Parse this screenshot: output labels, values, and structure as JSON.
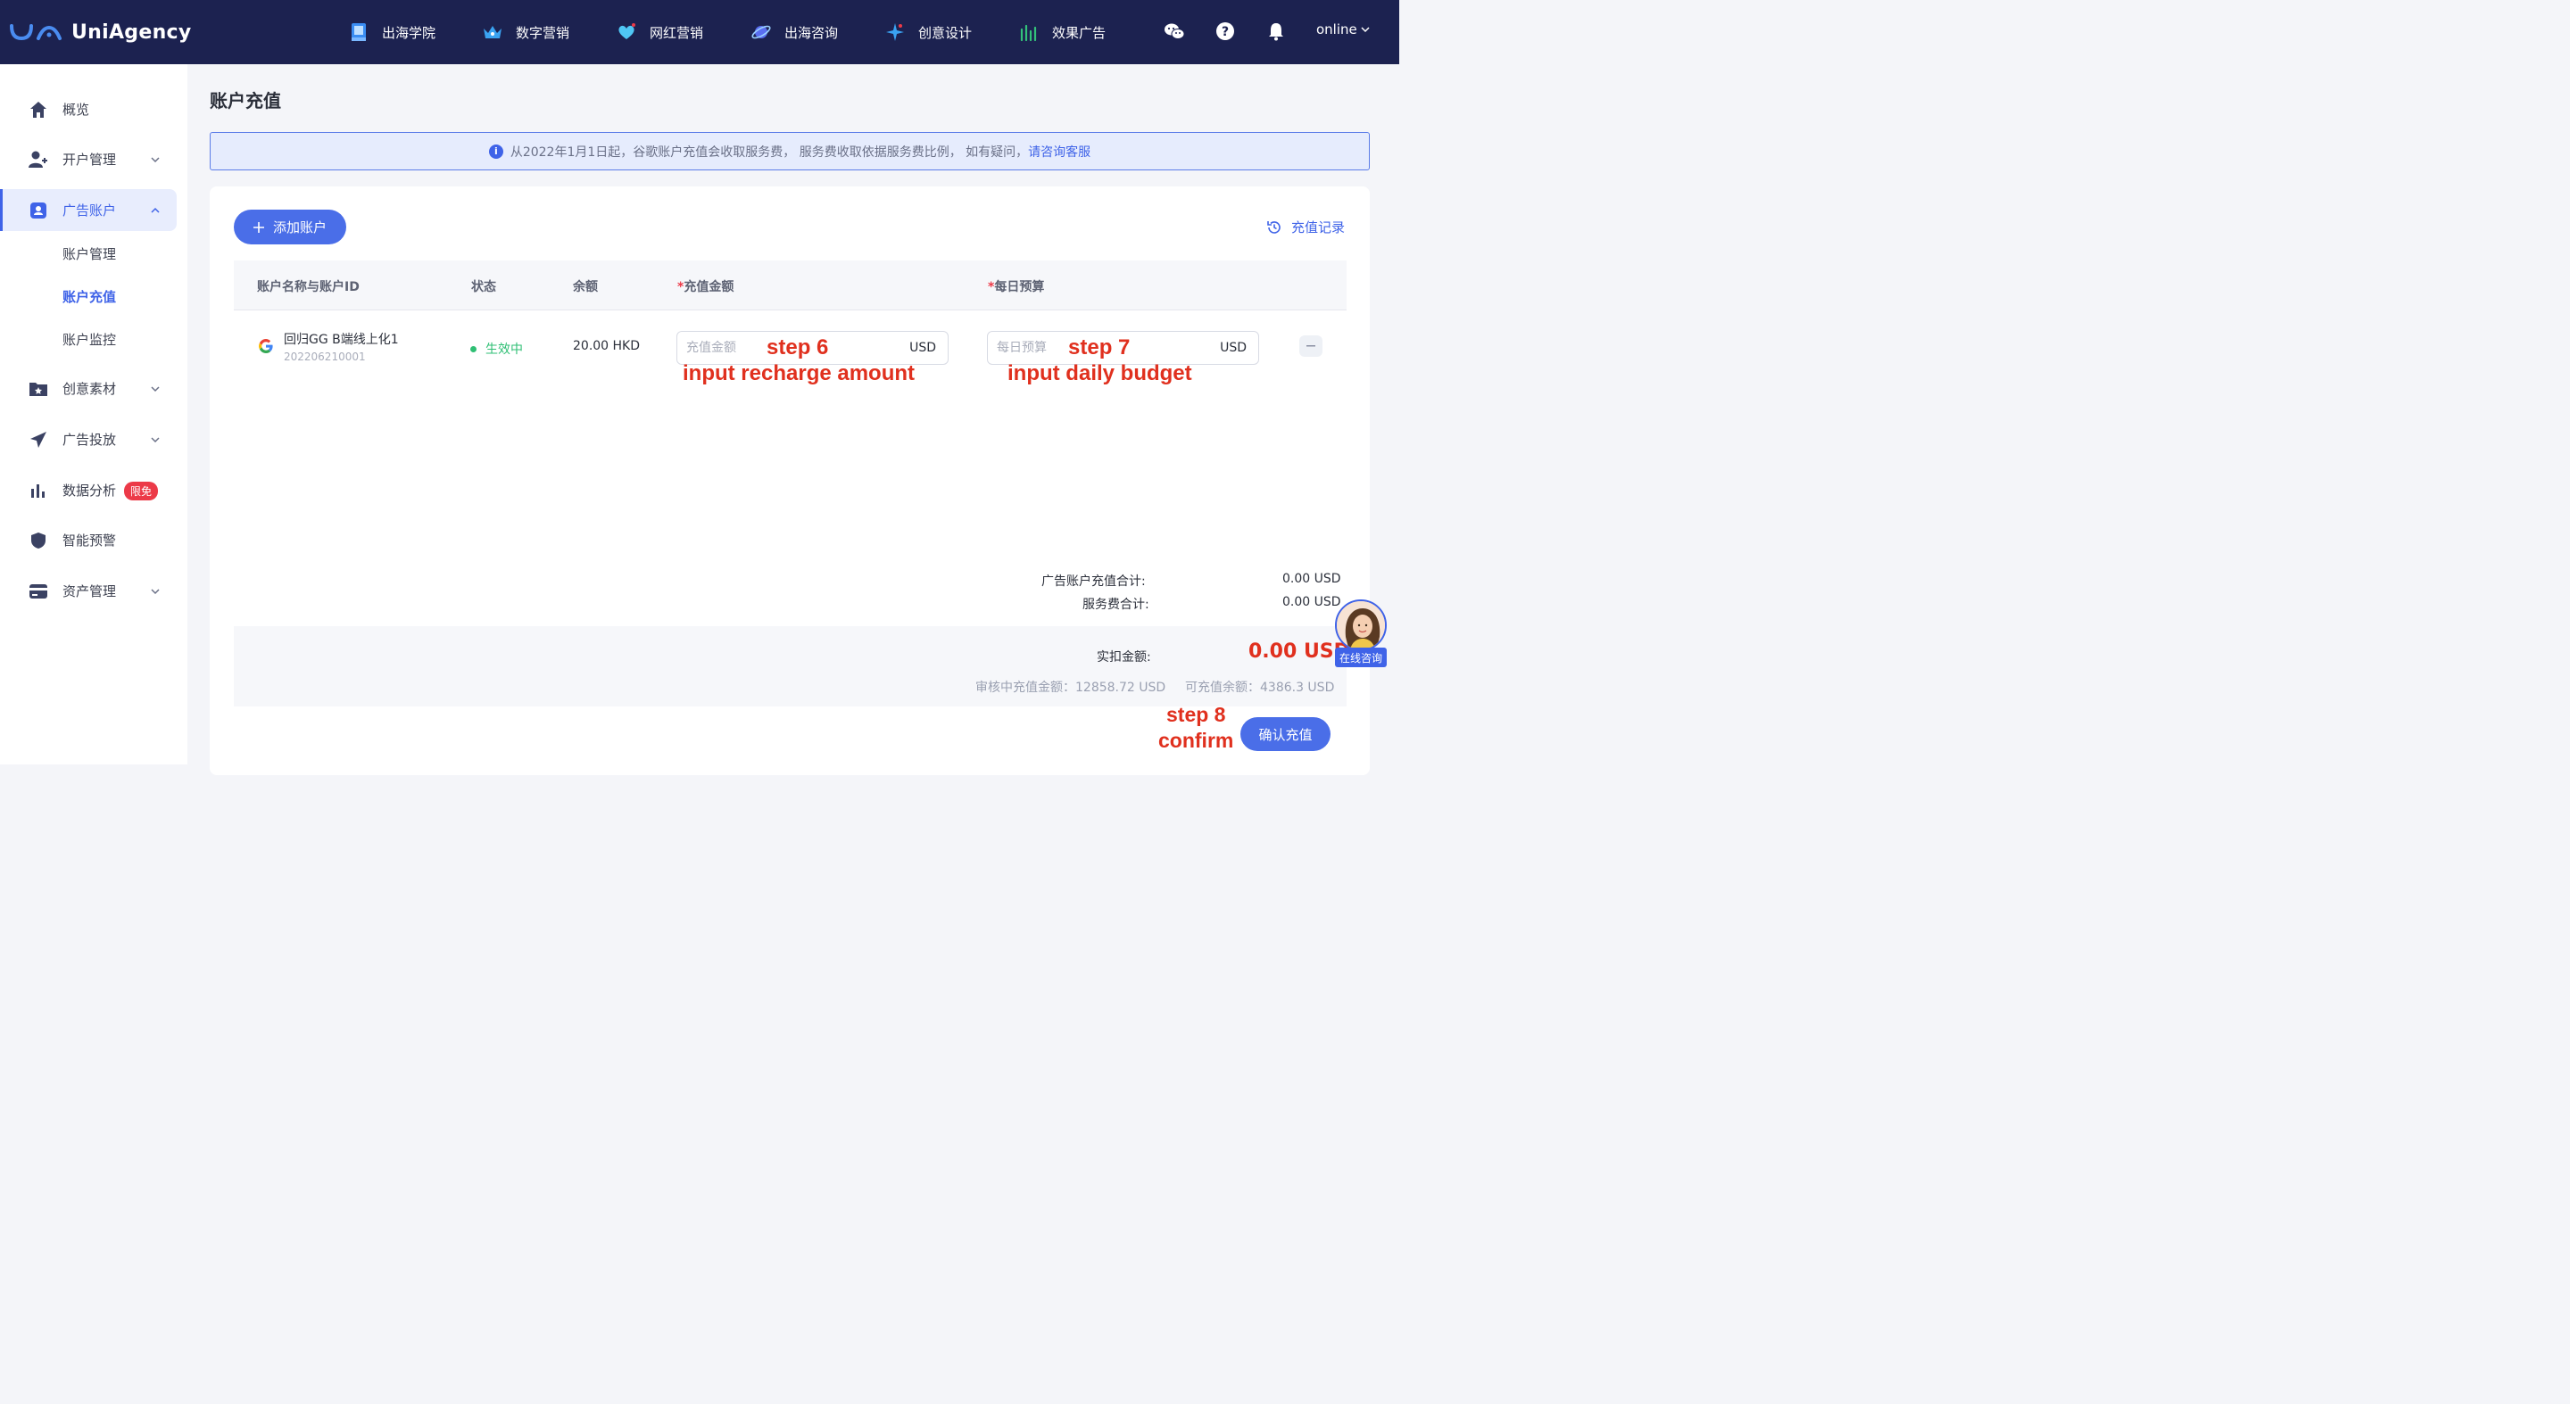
{
  "header": {
    "brand": "UniAgency",
    "nav": [
      {
        "label": "出海学院",
        "icon": "book-icon"
      },
      {
        "label": "数字营销",
        "icon": "crown-icon"
      },
      {
        "label": "网红营销",
        "icon": "heart-icon"
      },
      {
        "label": "出海咨询",
        "icon": "planet-icon"
      },
      {
        "label": "创意设计",
        "icon": "sparkle-icon"
      },
      {
        "label": "效果广告",
        "icon": "chart-icon"
      }
    ],
    "user": "online"
  },
  "sidebar": {
    "items": [
      {
        "label": "概览",
        "icon": "home-icon"
      },
      {
        "label": "开户管理",
        "icon": "user-add-icon"
      },
      {
        "label": "广告账户",
        "icon": "account-icon"
      },
      {
        "label": "创意素材",
        "icon": "folder-star-icon"
      },
      {
        "label": "广告投放",
        "icon": "send-icon"
      },
      {
        "label": "数据分析",
        "icon": "bar-chart-icon",
        "badge": "限免"
      },
      {
        "label": "智能预警",
        "icon": "shield-icon"
      },
      {
        "label": "资产管理",
        "icon": "card-icon"
      }
    ],
    "sub_items": [
      "账户管理",
      "账户充值",
      "账户监控"
    ]
  },
  "page": {
    "title": "账户充值",
    "notice_text": "从2022年1月1日起，谷歌账户充值会收取服务费，  服务费收取依据服务费比例，  如有疑问，",
    "notice_link": "请咨询客服",
    "add_account": "添加账户",
    "history": "充值记录"
  },
  "table": {
    "headers": {
      "account": "账户名称与账户ID",
      "status": "状态",
      "balance": "余额",
      "recharge_amount": "充值金额",
      "daily_budget": "每日预算"
    },
    "row": {
      "name": "回归GG B端线上化1",
      "id": "202206210001",
      "status": "生效中",
      "balance": "20.00 HKD",
      "recharge_placeholder": "充值金额",
      "recharge_unit": "USD",
      "budget_placeholder": "每日预算",
      "budget_unit": "USD"
    }
  },
  "annotations": {
    "step6": "step 6",
    "step6_desc": "input recharge amount",
    "step7": "step 7",
    "step7_desc": "input daily budget",
    "step8": "step 8",
    "step8_desc": "confirm"
  },
  "summary": {
    "recharge_total_label": "广告账户充值合计:",
    "recharge_total_value": "0.00 USD",
    "service_fee_label": "服务费合计:",
    "service_fee_value": "0.00 USD",
    "actual_label": "实扣金额:",
    "actual_value": "0.00 USD",
    "pending": "审核中充值金额：12858.72 USD",
    "available": "可充值余额：4386.3 USD",
    "confirm": "确认充值"
  },
  "chat": {
    "label": "在线咨询"
  }
}
